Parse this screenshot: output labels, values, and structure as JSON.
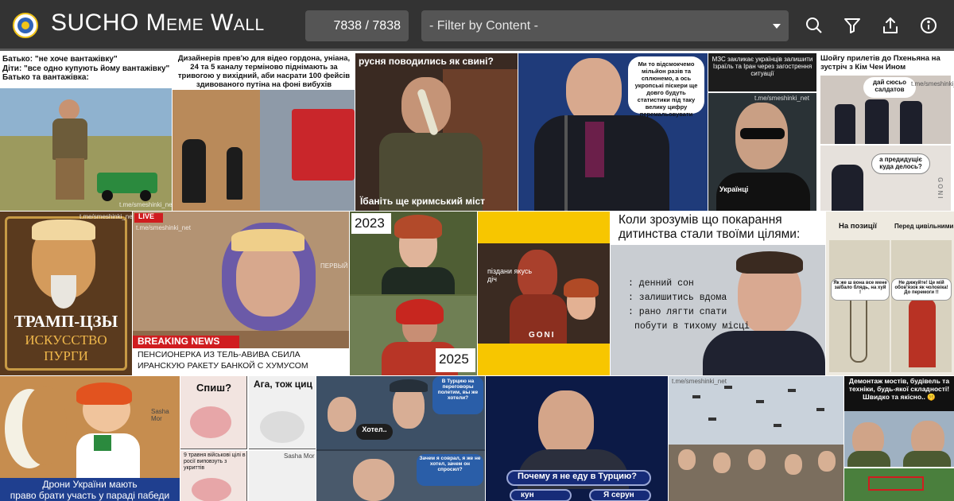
{
  "app": {
    "title": "SUCHO Meme Wall",
    "counter": "7838 / 7838",
    "filter_placeholder": "- Filter by Content -",
    "toolbar_icons": [
      "search-icon",
      "filter-icon",
      "share-icon",
      "info-icon"
    ]
  },
  "colors": {
    "topbar": "#333333",
    "control": "#555555",
    "accent_yellow": "#f7c600",
    "breaking_red": "#d01c1f"
  },
  "memes": {
    "m1": {
      "caption_l1": "Батько: \"не хоче вантажівку\"",
      "caption_l2": "Діти: \"все одно купують йому вантажівку\"",
      "caption_l3": "Батько та вантажівка:",
      "watermark": "t.me/smeshinki_net"
    },
    "m2": {
      "caption": "Дизайнерів прев'ю для відео гордона, уніана, 24 та 5 каналу терміново піднімають за тривогою у вихідний, аби насрати 100 фейсів здивованого путіна на фоні вибухів"
    },
    "m3": {
      "top": "русня поводились як свині?",
      "bottom": "Їбаніть ще кримський міст"
    },
    "m4": {
      "bubble": "Ми то відсмокчемо мільйон разів та сплюнемо, а ось укропські піскери ще довго будуть статистики під таку велику цифру перемальовувати"
    },
    "m5": {
      "header": "МЗС закликає українців залишити Ізраїль та Іран через загострення ситуації",
      "label": "Українці",
      "watermark": "t.me/smeshinki_net"
    },
    "m6": {
      "header": "Шойгу прилетів до Пхеньяна на зустріч з Кім Чен Ином",
      "bubble1": "дай сюсьо салдатов",
      "bubble2": "а предидущіє куда делось?",
      "tag": "GONI",
      "watermark": "t.me/smeshinki_net"
    },
    "m7": {
      "title": "ТРАМП-ЦЗЫ",
      "sub1": "ИСКУССТВО",
      "sub2": "ПУРГИ",
      "watermark": "t.me/smeshinki_net"
    },
    "m8": {
      "live": "LIVE",
      "breaking": "BREAKING NEWS",
      "line1": "ПЕНСИОНЕРКА ИЗ ТЕЛЬ-АВИВА СБИЛА",
      "line2": "ИРАНСКУЮ РАКЕТУ БАНКОЙ С ХУМУСОМ",
      "watermark": "t.me/smeshinki_net",
      "channel": "ПЕРВЫЙ"
    },
    "m9": {
      "year1": "2023",
      "year2": "2025"
    },
    "m10": {
      "bubble": "піздани якусь діч",
      "tag": "GONI"
    },
    "m11": {
      "title": "Коли зрозумів що покарання дитинства стали твоїми цілями:",
      "item1": ": денний сон",
      "item2": ": залишитись вдома",
      "item3": ": рано лягти спати",
      "item4": "побути в тихому місці"
    },
    "m12": {
      "label1": "На позиції",
      "label2": "Перед цивільними",
      "bubble1": "Як же ш вона все мене заїбало блядь, на хуй !",
      "bubble2": "Не дижуйте! Це мій обов'язок як чоловіка! До перемоги !!"
    },
    "m13": {
      "caption_l1": "Дрони України мають",
      "caption_l2": "право брати участь у параді пабеди",
      "author": "Sasha Mor"
    },
    "m14": {
      "b1": "Спиш?",
      "b2": "Ага, тож циц",
      "b3": "9 травня військові цілі в росії виповзуть з укриттів",
      "author": "Sasha Mor"
    },
    "m15": {
      "b1": "В Турцию на переговоры полетим, вы же хотели?",
      "b2": "Хотел..",
      "b3": "Зачем я соврал, я же не хотел, зачем он спросил?"
    },
    "m16": {
      "question": "Почему я не еду в Турцию?",
      "answer1": "Я серун",
      "answer2": "кун"
    },
    "m17": {
      "watermark": "t.me/smeshinki_net"
    },
    "m18": {
      "caption": "Демонтаж мостів, будівель та техніки, будь-якої складності! Швидко та якісно.. 🤫"
    }
  }
}
